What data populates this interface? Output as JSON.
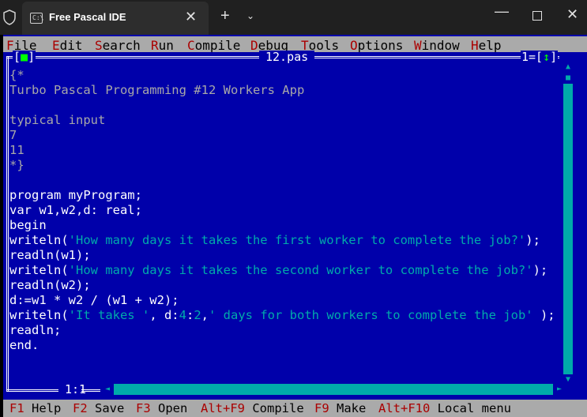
{
  "window": {
    "tab_title": "Free Pascal IDE",
    "tab_close": "✕",
    "new_tab": "+",
    "dropdown": "⌄",
    "minimize": "—",
    "close": "✕",
    "icons": {
      "shield": "shield-icon",
      "terminal": "terminal-icon"
    }
  },
  "menu": {
    "items": [
      {
        "hk": "F",
        "rest": "ile"
      },
      {
        "hk": "E",
        "rest": "dit"
      },
      {
        "hk": "S",
        "rest": "earch"
      },
      {
        "hk": "R",
        "rest": "un"
      },
      {
        "hk": "C",
        "rest": "ompile"
      },
      {
        "hk": "D",
        "rest": "ebug"
      },
      {
        "hk": "T",
        "rest": "ools"
      },
      {
        "hk": "O",
        "rest": "ptions"
      },
      {
        "hk": "W",
        "rest": "indow"
      },
      {
        "hk": "H",
        "rest": "elp"
      }
    ]
  },
  "editor": {
    "filename": "12.pas",
    "close_box_left": "[",
    "close_box_mark": "■",
    "close_box_right": "]",
    "window_number": "1=[",
    "window_zoom": "↕",
    "window_end": "]",
    "cursor_position": "1:1",
    "lines": [
      {
        "text": "{*",
        "style": "comment"
      },
      {
        "text": "Turbo Pascal Programming #12 Workers App",
        "style": "comment"
      },
      {
        "text": "",
        "style": "comment"
      },
      {
        "text": "typical input",
        "style": "comment"
      },
      {
        "text": "7",
        "style": "comment"
      },
      {
        "text": "11",
        "style": "comment"
      },
      {
        "text": "*}",
        "style": "comment"
      },
      {
        "text": "",
        "style": "plain"
      },
      {
        "text": "program myProgram;",
        "style": "plain"
      },
      {
        "text": "var w1,w2,d: real;",
        "style": "plain"
      },
      {
        "text": "begin",
        "style": "plain"
      },
      {
        "parts": [
          {
            "t": "writeln(",
            "s": "plain"
          },
          {
            "t": "'How many days it takes the first worker to complete the job?'",
            "s": "str"
          },
          {
            "t": ");",
            "s": "plain"
          }
        ]
      },
      {
        "text": "readln(w1);",
        "style": "plain"
      },
      {
        "parts": [
          {
            "t": "writeln(",
            "s": "plain"
          },
          {
            "t": "'How many days it takes the second worker to complete the job?'",
            "s": "str"
          },
          {
            "t": ");",
            "s": "plain"
          }
        ]
      },
      {
        "text": "readln(w2);",
        "style": "plain"
      },
      {
        "text": "d:=w1 * w2 / (w1 + w2);",
        "style": "plain"
      },
      {
        "parts": [
          {
            "t": "writeln(",
            "s": "plain"
          },
          {
            "t": "'It takes '",
            "s": "str"
          },
          {
            "t": ", d:",
            "s": "plain"
          },
          {
            "t": "4",
            "s": "num"
          },
          {
            "t": ":",
            "s": "plain"
          },
          {
            "t": "2",
            "s": "num"
          },
          {
            "t": ",",
            "s": "plain"
          },
          {
            "t": "' days for both workers to complete the job'",
            "s": "str"
          },
          {
            "t": " );",
            "s": "plain"
          }
        ]
      },
      {
        "text": "readln;",
        "style": "plain"
      },
      {
        "text": "end.",
        "style": "plain"
      }
    ]
  },
  "status": {
    "items": [
      {
        "key": "F1",
        "label": " Help"
      },
      {
        "key": "F2",
        "label": " Save"
      },
      {
        "key": "F3",
        "label": " Open"
      },
      {
        "key": "Alt+F9",
        "label": " Compile"
      },
      {
        "key": "F9",
        "label": " Make"
      },
      {
        "key": "Alt+F10",
        "label": " Local menu"
      }
    ]
  },
  "colors": {
    "editor_bg": "#0000aa",
    "menu_bg": "#aaaaaa",
    "hotkey": "#aa0000",
    "string": "#00aaaa",
    "comment": "#a8a8a8"
  }
}
